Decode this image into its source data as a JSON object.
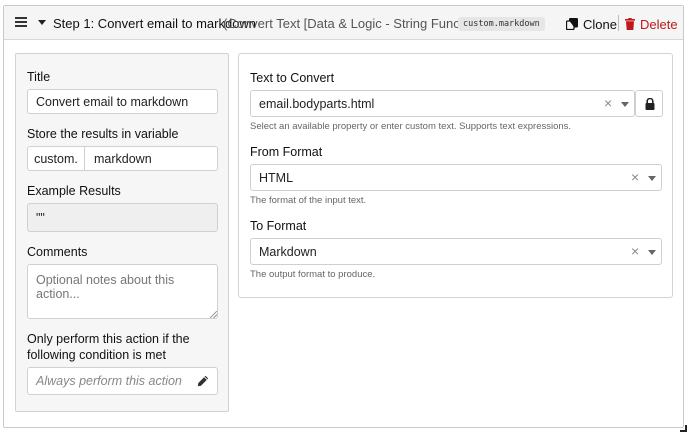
{
  "header": {
    "title": "Step 1: Convert email to markdown",
    "subtitle": "(Convert Text [Data & Logic - String Functions])",
    "code_badge": "custom.markdown",
    "clone_label": "Clone",
    "delete_label": "Delete"
  },
  "left": {
    "title_label": "Title",
    "title_value": "Convert email to markdown",
    "store_label": "Store the results in variable",
    "store_prefix": "custom.",
    "store_value": "markdown",
    "example_label": "Example Results",
    "example_value": "\"\"",
    "comments_label": "Comments",
    "comments_placeholder": "Optional notes about this action...",
    "condition_label": "Only perform this action if the following condition is met",
    "condition_placeholder": "Always perform this action"
  },
  "right": {
    "text_label": "Text to Convert",
    "text_value": "email.bodyparts.html",
    "text_hint": "Select an available property or enter custom text. Supports text expressions.",
    "from_label": "From Format",
    "from_value": "HTML",
    "from_hint": "The format of the input text.",
    "to_label": "To Format",
    "to_value": "Markdown",
    "to_hint": "The output format to produce."
  },
  "icons": {
    "menu": "hamburger-icon",
    "collapse": "caret-down-icon",
    "clone": "copy-icon",
    "delete": "trash-icon",
    "edit": "pencil-icon",
    "lock": "lock-icon",
    "clear": "clear-icon",
    "dropdown": "chevron-down-icon"
  },
  "colors": {
    "delete": "#c0181b",
    "header_bg": "#f5f5f5",
    "left_panel_bg": "#f6f6f6"
  }
}
